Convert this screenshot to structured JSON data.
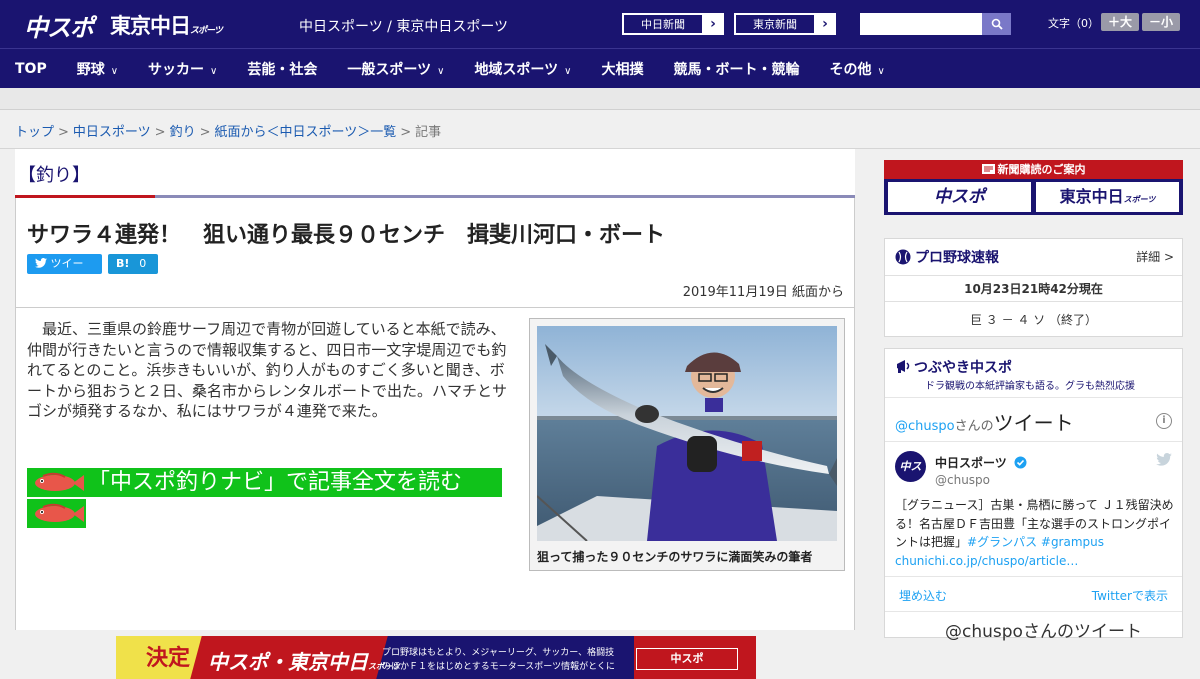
{
  "header": {
    "logo_chuspo": "中スポ",
    "logo_tokyo": "東京中日",
    "logo_tokyo_sub": "スポーツ",
    "site_name": "中日スポーツ / 東京中日スポーツ",
    "paper_links": [
      "中日新聞",
      "東京新聞"
    ],
    "search_placeholder": "",
    "fontsize_label": "文字（0）",
    "font_larger": "＋大",
    "font_smaller": "－小"
  },
  "nav": [
    {
      "label": "TOP",
      "has_menu": false
    },
    {
      "label": "野球",
      "has_menu": true
    },
    {
      "label": "サッカー",
      "has_menu": true
    },
    {
      "label": "芸能・社会",
      "has_menu": false
    },
    {
      "label": "一般スポーツ",
      "has_menu": true
    },
    {
      "label": "地域スポーツ",
      "has_menu": true
    },
    {
      "label": "大相撲",
      "has_menu": false
    },
    {
      "label": "競馬・ボート・競輪",
      "has_menu": false
    },
    {
      "label": "その他",
      "has_menu": true
    }
  ],
  "breadcrumb": {
    "items": [
      "トップ",
      "中日スポーツ",
      "釣り",
      "紙面から＜中日スポーツ＞一覧"
    ],
    "current": "記事"
  },
  "article": {
    "section": "【釣り】",
    "headline": "サワラ４連発！　狙い通り最長９０センチ　揖斐川河口・ボート",
    "tweet_label": "ツイート",
    "hatena_label": "B!",
    "hatena_count": "0",
    "dateline": "2019年11月19日 紙面から",
    "body": "最近、三重県の鈴鹿サーフ周辺で青物が回遊していると本紙で読み、仲間が行きたいと言うので情報収集すると、四日市一文字堤周辺でも釣れてるとのこと。浜歩きもいいが、釣り人がものすごく多いと聞き、ボートから狙おうと２日、桑名市からレンタルボートで出た。ハマチとサゴシが頻発するなか、私にはサワラが４連発で来た。",
    "readmore": "「中スポ釣りナビ」で記事全文を読む",
    "photo_caption": "狙って捕った９０センチのサワラに満面笑みの筆者"
  },
  "ad_banner": {
    "logo": "中スポ・東京中日",
    "logo_sub": "スポーツ",
    "tag": "決定",
    "text_line1": "プロ野球はもとより、メジャーリーグ、サッカー、格闘技",
    "text_line2": "のほかＦ１をはじめとするモータースポーツ情報がとくに",
    "button": "中スポ"
  },
  "sidebar": {
    "subscribe_head": "新聞購読のご案内",
    "sub_logo_1": "中スポ",
    "sub_logo_2": "東京中日",
    "sub_logo_2_small": "スポーツ",
    "baseball": {
      "title": "プロ野球速報",
      "link": "詳細 >",
      "time": "10月23日21時42分現在",
      "score": "巨 ３ － ４ ソ （終了）"
    },
    "tsubuyaki": {
      "title": "つぶやき中スポ",
      "subtitle": "ドラ観戦の本紙評論家も語る。グラも熱烈応援",
      "handle_link": "@chuspo",
      "handle_suffix": "さんの",
      "tweets_word": "ツイート",
      "account_name": "中日スポーツ",
      "account_handle": "@chuspo",
      "tweet_text": "［グラニュース］古巣・鳥栖に勝って Ｊ１残留決める！名古屋ＤＦ吉田豊「主な選手のストロングポイントは把握」",
      "tweet_tags": "#グランパス #grampus",
      "tweet_url": "chunichi.co.jp/chuspo/article…",
      "embed": "埋め込む",
      "view_on_twitter": "Twitterで表示",
      "footer_tweets": "@chuspoさんのツイート"
    }
  },
  "colors": {
    "brand_navy": "#1a1470",
    "accent_red": "#c0161e",
    "link_blue": "#1a5ab0",
    "readmore_green": "#10c21a",
    "twitter_blue": "#1da1f2"
  }
}
